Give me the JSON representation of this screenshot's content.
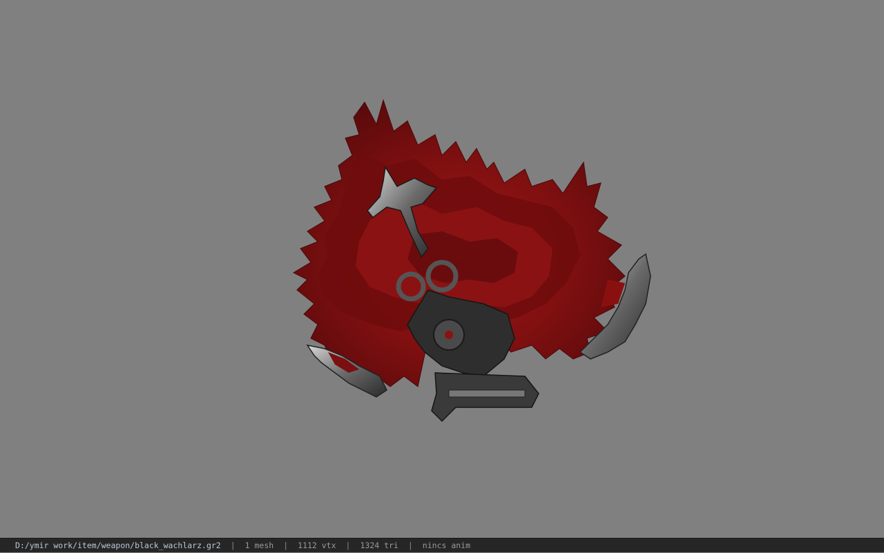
{
  "viewer": {
    "background_color": "#808080",
    "model": {
      "name": "black_wachlarz",
      "description_icon": "red-feather-fan-weapon",
      "feather_color": "#8b1212",
      "metal_color": "#3a3a3a"
    }
  },
  "status_bar": {
    "file_path": "D:/ymir work/item/weapon/black_wachlarz.gr2",
    "separator": "|",
    "mesh_count": "1 mesh",
    "vertex_count": "1112 vtx",
    "triangle_count": "1324 tri",
    "animation": "nincs anim"
  }
}
